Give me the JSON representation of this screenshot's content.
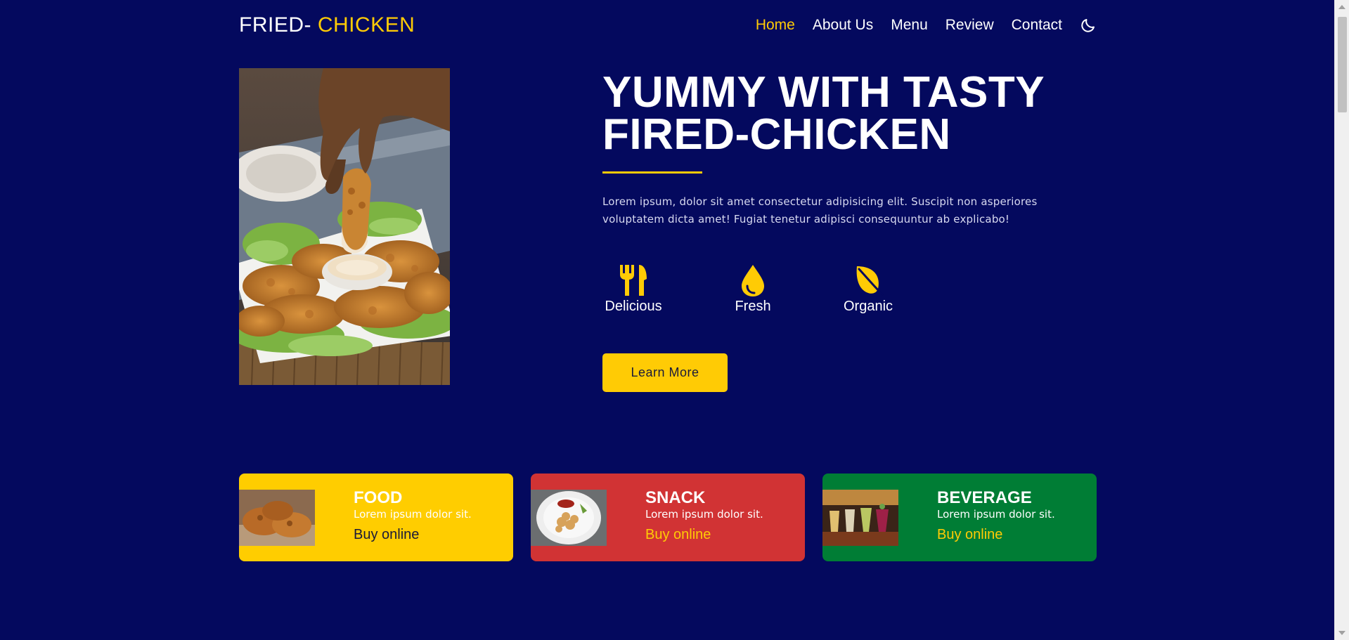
{
  "header": {
    "logo_main": "FRIED- ",
    "logo_accent": "CHICKEN",
    "nav": [
      "Home",
      "About Us",
      "Menu",
      "Review",
      "Contact"
    ],
    "active_nav": "Home",
    "theme_toggle_icon": "moon-icon"
  },
  "hero": {
    "title_line1": "YUMMY WITH TASTY",
    "title_line2": "FIRED-CHICKEN",
    "description": "Lorem ipsum, dolor sit amet consectetur adipisicing elit. Suscipit non asperiores voluptatem dicta amet! Fugiat tenetur adipisci consequuntur ab explicabo!",
    "features": [
      {
        "label": "Delicious",
        "icon": "utensils-icon"
      },
      {
        "label": "Fresh",
        "icon": "drop-icon"
      },
      {
        "label": "Organic",
        "icon": "leaf-icon"
      }
    ],
    "button_label": "Learn More"
  },
  "categories": [
    {
      "title": "FOOD",
      "subtitle": "Lorem ipsum dolor sit.",
      "link": "Buy online"
    },
    {
      "title": "SNACK",
      "subtitle": "Lorem ipsum dolor sit.",
      "link": "Buy online"
    },
    {
      "title": "BEVERAGE",
      "subtitle": "Lorem ipsum dolor sit.",
      "link": "Buy online"
    }
  ],
  "colors": {
    "background": "#04095e",
    "accent": "#ffcb05",
    "food": "#ffcd00",
    "snack": "#d13334",
    "beverage": "#007d35"
  }
}
